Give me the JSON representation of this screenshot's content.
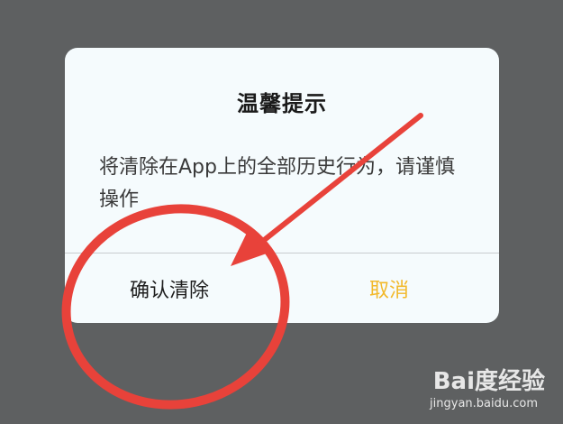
{
  "dialog": {
    "title": "温馨提示",
    "message": "将清除在App上的全部历史行为，请谨慎操作",
    "confirm_label": "确认清除",
    "cancel_label": "取消"
  },
  "watermark": {
    "logo": "Bai度经验",
    "url": "jingyan.baidu.com"
  },
  "colors": {
    "backdrop": "#5e6061",
    "dialog_bg": "#f5fbfd",
    "cancel_text": "#f2b92a",
    "annotation_red": "#e8423a"
  },
  "icons": {
    "annotation": "red-circle-and-arrow",
    "watermark": "baidu-paw-icon"
  }
}
